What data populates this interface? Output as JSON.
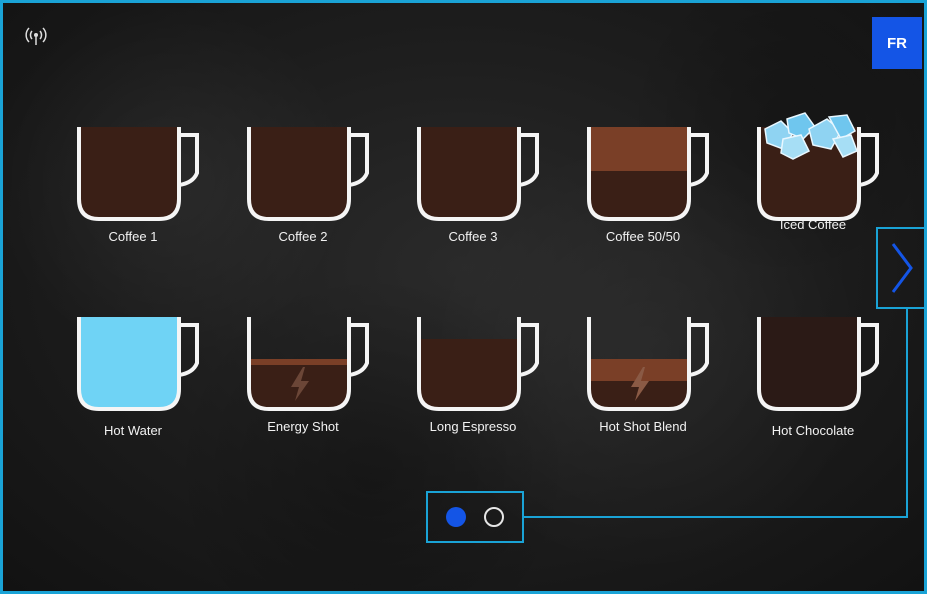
{
  "header": {
    "language_button": "FR"
  },
  "colors": {
    "accent": "#1aa3d6",
    "primary_blue": "#1455e6",
    "coffee": "#3a1f16",
    "crema": "#7a3f27",
    "water": "#6fd3f5"
  },
  "icons": {
    "status": "wifi-signal-icon",
    "next": "chevron-right-icon",
    "energy": "lightning-bolt-icon"
  },
  "drinks": [
    {
      "label": "Coffee 1"
    },
    {
      "label": "Coffee 2"
    },
    {
      "label": "Coffee 3"
    },
    {
      "label": "Coffee 50/50"
    },
    {
      "label": "Iced Coffee"
    },
    {
      "label": "Hot Water"
    },
    {
      "label": "Energy Shot"
    },
    {
      "label": "Long Espresso"
    },
    {
      "label": "Hot Shot Blend"
    },
    {
      "label": "Hot Chocolate"
    }
  ],
  "pagination": {
    "current_page": 1,
    "total_pages": 2
  }
}
